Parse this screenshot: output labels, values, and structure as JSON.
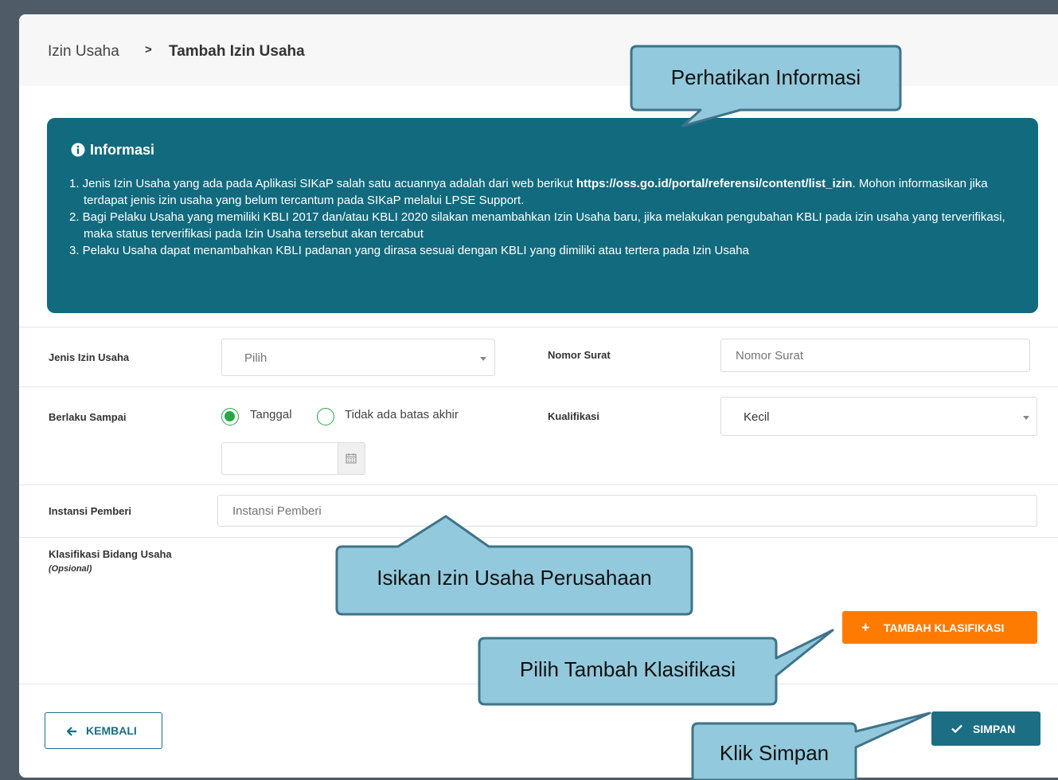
{
  "breadcrumb": {
    "parent": "Izin Usaha",
    "separator": ">",
    "current": "Tambah Izin Usaha"
  },
  "info": {
    "title": "Informasi",
    "items": [
      {
        "prefix": "1. Jenis Izin Usaha yang ada pada Aplikasi SIKaP salah satu acuannya adalah dari web berikut ",
        "link": "https://oss.go.id/portal/referensi/content/list_izin",
        "suffix": ". Mohon informasikan jika terdapat jenis izin usaha yang belum tercantum pada SIKaP melalui LPSE Support."
      },
      {
        "text": "2. Bagi Pelaku Usaha yang memiliki KBLI 2017 dan/atau KBLI 2020 silakan menambahkan Izin Usaha baru, jika melakukan pengubahan KBLI pada izin usaha yang terverifikasi, maka status terverifikasi pada Izin Usaha tersebut akan tercabut"
      },
      {
        "text": "3. Pelaku Usaha dapat menambahkan KBLI padanan yang dirasa sesuai dengan KBLI yang dimiliki atau tertera pada Izin Usaha"
      }
    ]
  },
  "form": {
    "jenis_label": "Jenis Izin Usaha",
    "jenis_value": "Pilih",
    "nomor_label": "Nomor Surat",
    "nomor_placeholder": "Nomor Surat",
    "berlaku_label": "Berlaku Sampai",
    "radio_tanggal": "Tanggal",
    "radio_tidak": "Tidak ada batas akhir",
    "kualifikasi_label": "Kualifikasi",
    "kualifikasi_value": "Kecil",
    "instansi_label": "Instansi Pemberi",
    "instansi_placeholder": "Instansi Pemberi",
    "klasifikasi_label": "Klasifikasi Bidang Usaha",
    "klasifikasi_note": "(Opsional)"
  },
  "buttons": {
    "tambah": "TAMBAH KLASIFIKASI",
    "tambah_icon": "plus-icon",
    "kembali": "KEMBALI",
    "kembali_icon": "arrow-left-icon",
    "simpan": "SIMPAN",
    "simpan_icon": "check-icon"
  },
  "callouts": {
    "perhatikan": "Perhatikan Informasi",
    "isikan": "Isikan Izin Usaha Perusahaan",
    "pilih": "Pilih Tambah Klasifikasi",
    "klik": "Klik Simpan"
  },
  "colors": {
    "info_bg": "#126a7e",
    "accent": "#1b6e83",
    "orange": "#ff7a00",
    "green": "#28a745",
    "callout_fill": "#93c9dc",
    "callout_border": "#3e7489"
  }
}
